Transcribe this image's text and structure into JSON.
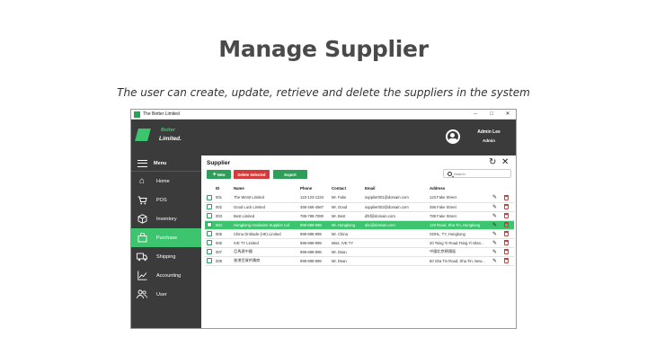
{
  "slide": {
    "title": "Manage Supplier",
    "subtitle": "The user can create, update, retrieve and delete the suppliers in the system"
  },
  "window": {
    "title": "The Better Limited",
    "controls": [
      "–",
      "□",
      "✕"
    ]
  },
  "header": {
    "logo_line1": "Better",
    "logo_line2": "Limited.",
    "user_name": "Admin Lee",
    "user_role": "Admin"
  },
  "sidebar": {
    "menu_label": "Menu",
    "items": [
      {
        "label": "Home",
        "icon": "home-icon"
      },
      {
        "label": "POS",
        "icon": "cart-icon"
      },
      {
        "label": "Inventory",
        "icon": "box-icon"
      },
      {
        "label": "Purchase",
        "icon": "bag-icon",
        "active": true
      },
      {
        "label": "Shipping",
        "icon": "truck-icon"
      },
      {
        "label": "Accounting",
        "icon": "chart-icon"
      },
      {
        "label": "User",
        "icon": "users-icon"
      }
    ]
  },
  "content": {
    "title": "Supplier",
    "new_label": "New",
    "delete_label": "Delete Selected",
    "export_label": "Export",
    "search_placeholder": "Search",
    "columns": [
      "ID",
      "Name",
      "Phone",
      "Contact",
      "Email",
      "Address"
    ],
    "rows": [
      {
        "id": "001",
        "name": "The Worst Limited",
        "phone": "123-123-1234",
        "contact": "Mr. Fake",
        "email": "supplier001@domain.com",
        "address": "123 Fake Street"
      },
      {
        "id": "002",
        "name": "Good Luck Limited",
        "phone": "456-456-4567",
        "contact": "Mr. Good",
        "email": "supplier002@domain.com",
        "address": "456 Fake Street"
      },
      {
        "id": "003",
        "name": "Best Limited",
        "phone": "789-789-7890",
        "contact": "Mr. Best",
        "email": "dfsf@domain.com",
        "address": "789 Fake Street"
      },
      {
        "id": "004",
        "name": "Hongkong Hardware Supplier Ltd",
        "phone": "999-999-999",
        "contact": "Mr. Hongkong",
        "email": "abc@domain.com",
        "address": "123 Road, Sha Tin, Hongkong",
        "selected": true
      },
      {
        "id": "005",
        "name": "China Onitrade (HK) Limited",
        "phone": "999-999-999",
        "contact": "Mr. China",
        "email": "",
        "address": "SOHL, TY, Hongkong"
      },
      {
        "id": "006",
        "name": "IVE TY Limited",
        "phone": "999-999-999",
        "contact": "Miss. IVE TY",
        "email": "",
        "address": "20 Tsing Yi Road,Tsing Yi Islan..."
      },
      {
        "id": "007",
        "name": "亞馬遜中國",
        "phone": "999-999-999",
        "contact": "Mr. Dsan",
        "email": "",
        "address": "中國北京朝陽區"
      },
      {
        "id": "008",
        "name": "香港百貨供應商",
        "phone": "999-999-999",
        "contact": "Mr. Dsan",
        "email": "",
        "address": "50 Sha Tin Road, Sha Tin, New..."
      }
    ]
  }
}
